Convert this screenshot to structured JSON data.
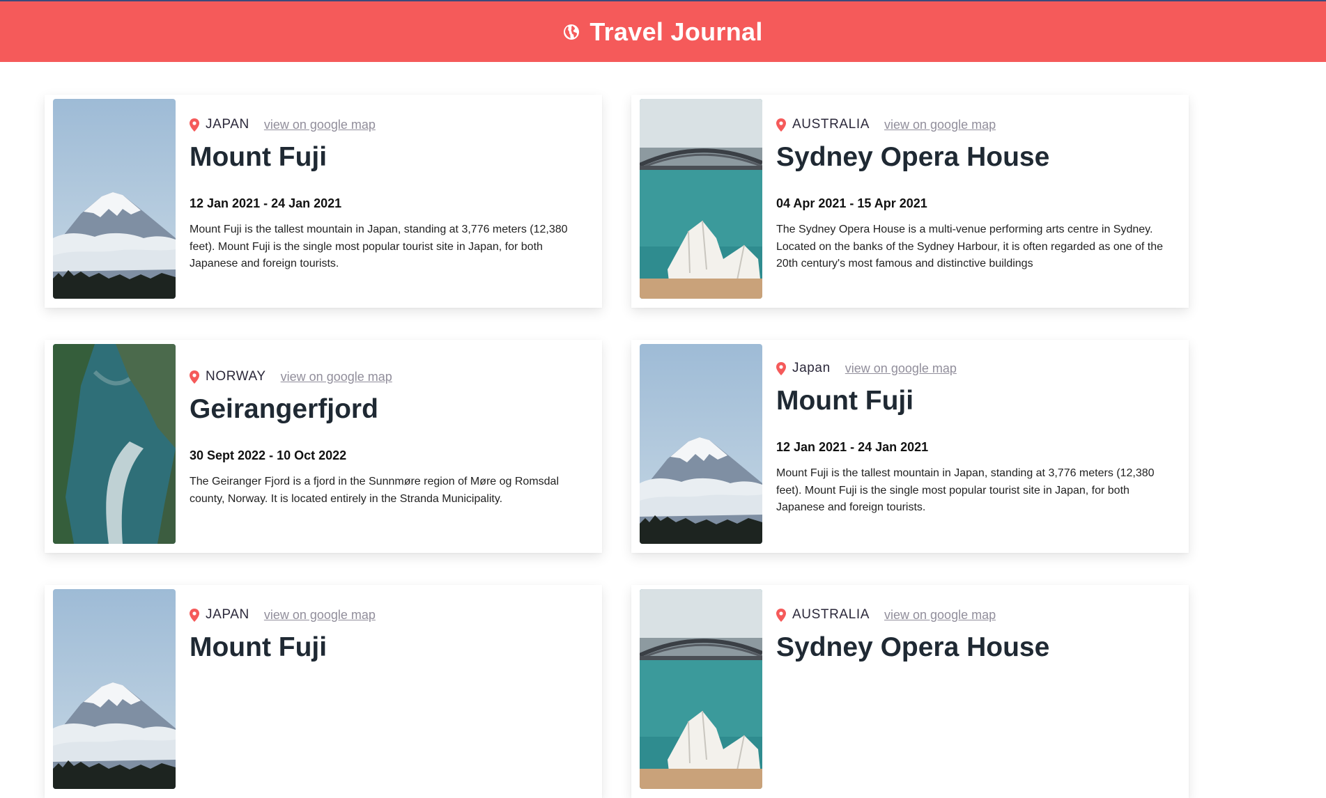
{
  "header": {
    "title": "Travel Journal",
    "icon": "globe-icon",
    "background": "#f55a5a"
  },
  "link_label": "view on google map",
  "entries": [
    {
      "country": "JAPAN",
      "place": "Mount Fuji",
      "dates": "12 Jan 2021 - 24 Jan 2021",
      "description": "Mount Fuji is the tallest mountain in Japan, standing at 3,776 meters (12,380 feet). Mount Fuji is the single most popular tourist site in Japan, for both Japanese and foreign tourists.",
      "image": "mount-fuji-photo"
    },
    {
      "country": "AUSTRALIA",
      "place": "Sydney Opera House",
      "dates": "04 Apr 2021 - 15 Apr 2021",
      "description": "The Sydney Opera House is a multi-venue performing arts centre in Sydney. Located on the banks of the Sydney Harbour, it is often regarded as one of the 20th century's most famous and distinctive buildings",
      "image": "sydney-opera-house-photo"
    },
    {
      "country": "NORWAY",
      "place": "Geirangerfjord",
      "dates": "30 Sept 2022 - 10 Oct 2022",
      "description": "The Geiranger Fjord is a fjord in the Sunnmøre region of Møre og Romsdal county, Norway. It is located entirely in the Stranda Municipality.",
      "image": "geirangerfjord-photo"
    },
    {
      "country": "Japan",
      "place": "Mount Fuji",
      "dates": "12 Jan 2021 - 24 Jan 2021",
      "description": "Mount Fuji is the tallest mountain in Japan, standing at 3,776 meters (12,380 feet). Mount Fuji is the single most popular tourist site in Japan, for both Japanese and foreign tourists.",
      "image": "mount-fuji-photo"
    },
    {
      "country": "JAPAN",
      "place": "Mount Fuji",
      "image": "mount-fuji-photo"
    },
    {
      "country": "AUSTRALIA",
      "place": "Sydney Opera House",
      "image": "sydney-opera-house-photo"
    }
  ]
}
